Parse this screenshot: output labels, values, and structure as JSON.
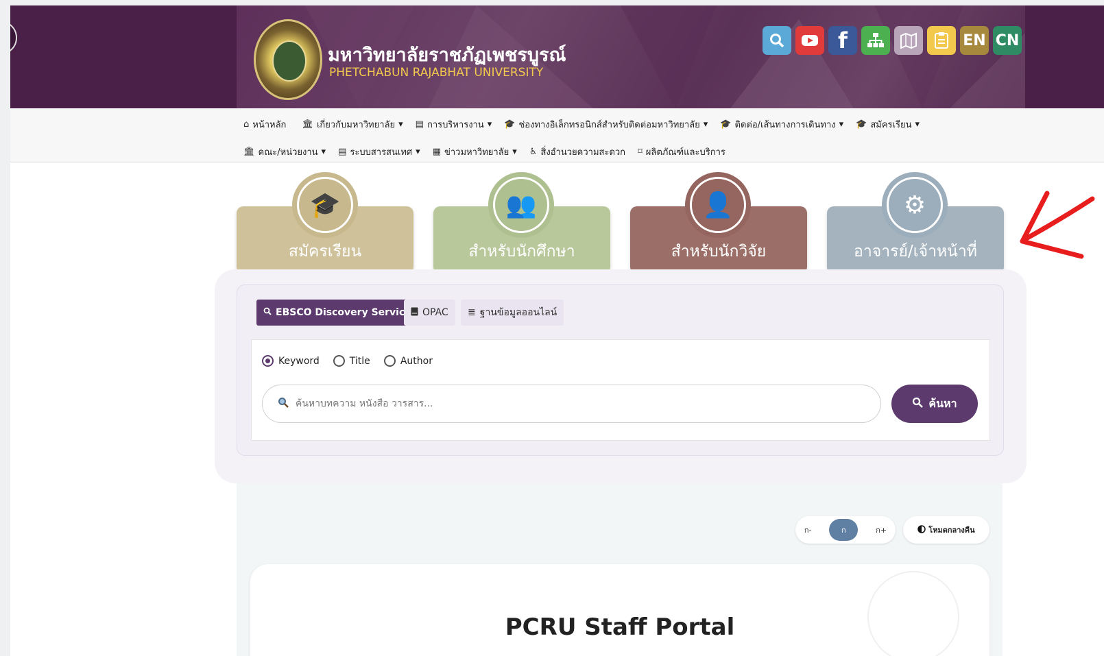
{
  "header": {
    "uni_name_th": "มหาวิทยาลัยราชภัฏเพชรบูรณ์",
    "uni_name_en": "PHETCHABUN RAJABHAT UNIVERSITY",
    "icons": [
      "search-icon",
      "youtube-icon",
      "facebook-icon",
      "sitemap-icon",
      "map-icon",
      "document-icon"
    ],
    "lang_en": "EN",
    "lang_cn": "CN",
    "fb_glyph": "f"
  },
  "nav": {
    "row1": [
      {
        "label": "หน้าหลัก",
        "icon": "home-icon",
        "glyph": "⌂",
        "dropdown": ""
      },
      {
        "label": "เกี่ยวกับมหาวิทยาลัย",
        "icon": "building-icon",
        "glyph": "🏛",
        "dropdown": "▾"
      },
      {
        "label": "การบริหารงาน",
        "icon": "presentation-icon",
        "glyph": "▤",
        "dropdown": "▾"
      },
      {
        "label": "ช่องทางอิเล็กทรอนิกส์สำหรับติดต่อมหาวิทยาลัย",
        "icon": "graduation-cap-icon",
        "glyph": "🎓",
        "dropdown": "▾"
      },
      {
        "label": "ติดต่อ/เส้นทางการเดินทาง",
        "icon": "graduation-cap-icon",
        "glyph": "🎓",
        "dropdown": "▾"
      },
      {
        "label": "สมัครเรียน",
        "icon": "graduation-cap-icon",
        "glyph": "🎓",
        "dropdown": "▾"
      }
    ],
    "row2": [
      {
        "label": "คณะ/หน่วยงาน",
        "icon": "building-icon",
        "glyph": "🏛",
        "dropdown": "▾"
      },
      {
        "label": "ระบบสารสนเทศ",
        "icon": "presentation-icon",
        "glyph": "▤",
        "dropdown": "▾"
      },
      {
        "label": "ข่าวมหาวิทยาลัย",
        "icon": "newspaper-icon",
        "glyph": "▦",
        "dropdown": "▾"
      },
      {
        "label": "สิ่งอำนวยความสะดวก",
        "icon": "wheelchair-icon",
        "glyph": "♿",
        "dropdown": ""
      },
      {
        "label": "ผลิตภัณฑ์และบริการ",
        "icon": "bookmark-icon",
        "glyph": "⌑",
        "dropdown": ""
      }
    ]
  },
  "tiles": [
    {
      "label": "สมัครเรียน",
      "icon": "graduation-cap-icon",
      "glyph": "🎓",
      "color": "#cfc29a",
      "circle": "#c7b98d"
    },
    {
      "label": "สำหรับนักศึกษา",
      "icon": "students-icon",
      "glyph": "👥",
      "color": "#b8c89a",
      "circle": "#afc090"
    },
    {
      "label": "สำหรับนักวิจัย",
      "icon": "researchers-icon",
      "glyph": "👤",
      "color": "#9b6e67",
      "circle": "#94665f"
    },
    {
      "label": "อาจารย์/เจ้าหน้าที่",
      "icon": "staff-gear-icon",
      "glyph": "⚙",
      "color": "#a4b3bd",
      "circle": "#9caebb"
    }
  ],
  "search": {
    "tabs": [
      {
        "label": "EBSCO Discovery Service",
        "icon": "search-icon",
        "glyph": "🔍"
      },
      {
        "label": "OPAC",
        "icon": "book-icon",
        "glyph": "▬"
      },
      {
        "label": "ฐานข้อมูลออนไลน์",
        "icon": "database-icon",
        "glyph": "≣"
      }
    ],
    "radios": [
      {
        "label": "Keyword",
        "checked": true
      },
      {
        "label": "Title",
        "checked": false
      },
      {
        "label": "Author",
        "checked": false
      }
    ],
    "placeholder": "ค้นหาบทความ หนังสือ วารสาร...",
    "button_label": "ค้นหา"
  },
  "accessibility": {
    "decrease": "ก-",
    "normal": "ก",
    "increase": "ก+",
    "dark_mode": "โหมดกลางคืน"
  },
  "portal": {
    "title": "PCRU Staff Portal"
  }
}
